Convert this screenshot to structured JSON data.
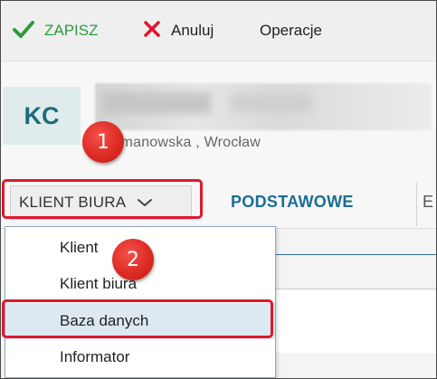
{
  "toolbar": {
    "save_label": "ZAPISZ",
    "cancel_label": "Anuluj",
    "operations_label": "Operacje"
  },
  "client": {
    "avatar_initials": "KC",
    "address": "...ermanowska ,  Wrocław"
  },
  "view_select": {
    "selected_label": "KLIENT BIURA"
  },
  "tabs": {
    "active_label": "PODSTAWOWE",
    "next_label": "E"
  },
  "dropdown": {
    "items": [
      {
        "label": "Klient"
      },
      {
        "label": "Klient biura"
      },
      {
        "label": "Baza danych"
      },
      {
        "label": "Informator"
      }
    ]
  },
  "annotations": {
    "badge_1": "1",
    "badge_2": "2"
  },
  "colors": {
    "save_green": "#2e9a3c",
    "cancel_red": "#e0182c",
    "accent_blue": "#1a6e92",
    "highlight_red": "#e0182c",
    "selected_item_bg": "#dde9f2"
  },
  "icons": {
    "save": "check-icon",
    "cancel": "close-icon",
    "select": "chevron-down-icon"
  }
}
